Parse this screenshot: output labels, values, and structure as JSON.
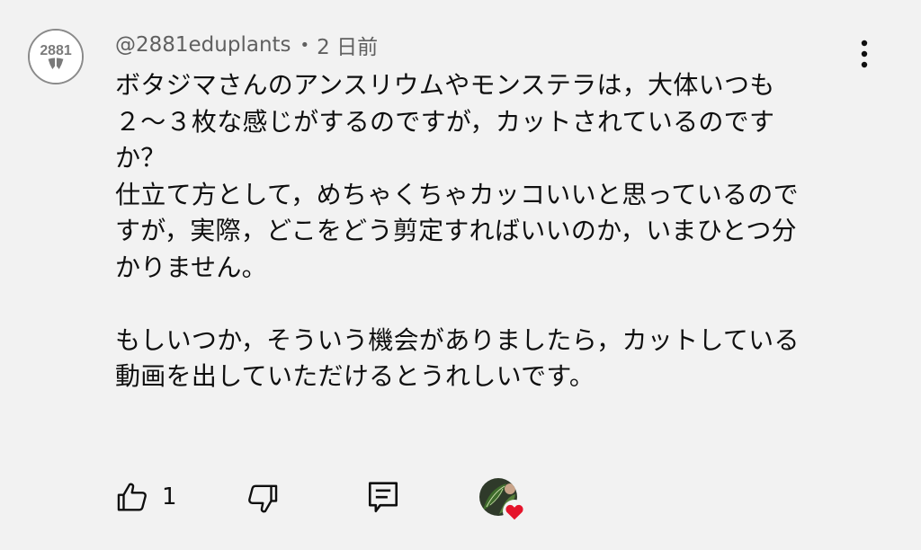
{
  "comment": {
    "author": "@2881eduplants",
    "separator": "•",
    "timestamp": "2 日前",
    "avatar_text": "2881",
    "lines": [
      "ボタジマさんのアンスリウムやモンステラは，大体いつも",
      "２〜３枚な感じがするのですが，カットされているのです",
      "か？",
      "仕立て方として，めちゃくちゃカッコいいと思っているので",
      "すが，実際，どこをどう剪定すればいいのか，いまひとつ分",
      "かりません。",
      "",
      "もしいつか，そういう機会がありましたら，カットしている",
      "動画を出していただけるとうれしいです。"
    ]
  },
  "actions": {
    "like_count": "1",
    "like_icon": "thumb-up-icon",
    "dislike_icon": "thumb-down-icon",
    "reply_icon": "comment-reply-icon",
    "heart_icon": "heart-icon"
  },
  "colors": {
    "background": "#f2f2f2",
    "text": "#0f0f0f",
    "meta": "#606060",
    "heart": "#e5142b"
  }
}
